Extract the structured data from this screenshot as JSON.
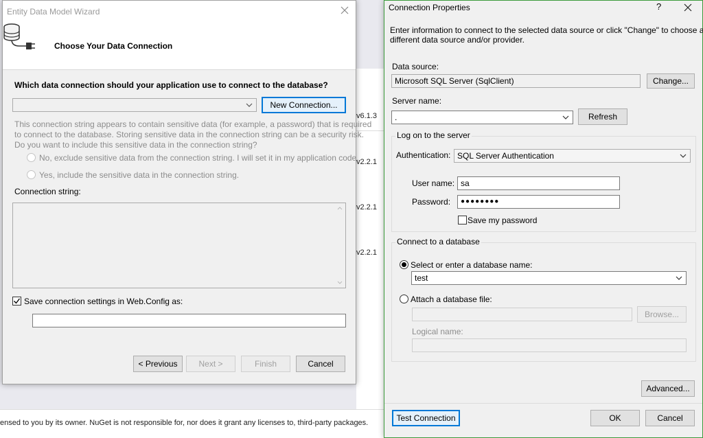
{
  "background": {
    "version_1": "v6.1.3",
    "version_2": "v2.2.1",
    "version_3": "v2.2.1",
    "version_4": "v2.2.1",
    "footer_text": "ensed to you by its owner. NuGet is not responsible for, nor does it grant any licenses to, third-party packages."
  },
  "wizard": {
    "title": "Entity Data Model Wizard",
    "heading": "Choose Your Data Connection",
    "question": "Which data connection should your application use to connect to the database?",
    "connection_select_value": "",
    "new_connection_label": "New Connection...",
    "sensitive_text_1": "This connection string appears to contain sensitive data (for example, a password) that is required",
    "sensitive_text_2": "to connect to the database. Storing sensitive data in the connection string can be a security risk.",
    "sensitive_text_3": "Do you want to include this sensitive data in the connection string?",
    "radio_exclude_label": "No, exclude sensitive data from the connection string. I will set it in my application code.",
    "radio_include_label": "Yes, include the sensitive data in the connection string.",
    "connection_string_label": "Connection string:",
    "connection_string_value": "",
    "save_settings_label": "Save connection settings in Web.Config as:",
    "save_settings_checked": true,
    "config_name_value": "",
    "previous_label": "< Previous",
    "next_label": "Next >",
    "finish_label": "Finish",
    "cancel_label": "Cancel"
  },
  "connection_properties": {
    "title": "Connection Properties",
    "help_glyph": "?",
    "intro_1": "Enter information to connect to the selected data source or click \"Change\" to choose a",
    "intro_2": "different data source and/or provider.",
    "data_source_label": "Data source:",
    "data_source_value": "Microsoft SQL Server (SqlClient)",
    "change_label": "Change...",
    "server_name_label": "Server name:",
    "server_name_value": ".",
    "refresh_label": "Refresh",
    "logon_group_title": "Log on to the server",
    "authentication_label": "Authentication:",
    "authentication_value": "SQL Server Authentication",
    "user_name_label": "User name:",
    "user_name_value": "sa",
    "password_label": "Password:",
    "password_value": "●●●●●●●●",
    "save_password_label": "Save my password",
    "save_password_checked": false,
    "database_group_title": "Connect to a database",
    "select_db_label": "Select or enter a database name:",
    "select_db_value": "test",
    "attach_db_label": "Attach a database file:",
    "attach_db_value": "",
    "browse_label": "Browse...",
    "logical_name_label": "Logical name:",
    "logical_name_value": "",
    "advanced_label": "Advanced...",
    "test_connection_label": "Test Connection",
    "ok_label": "OK",
    "cancel_label": "Cancel"
  },
  "colors": {
    "accent": "#0078d7",
    "cp_border": "#3a9a3a"
  }
}
